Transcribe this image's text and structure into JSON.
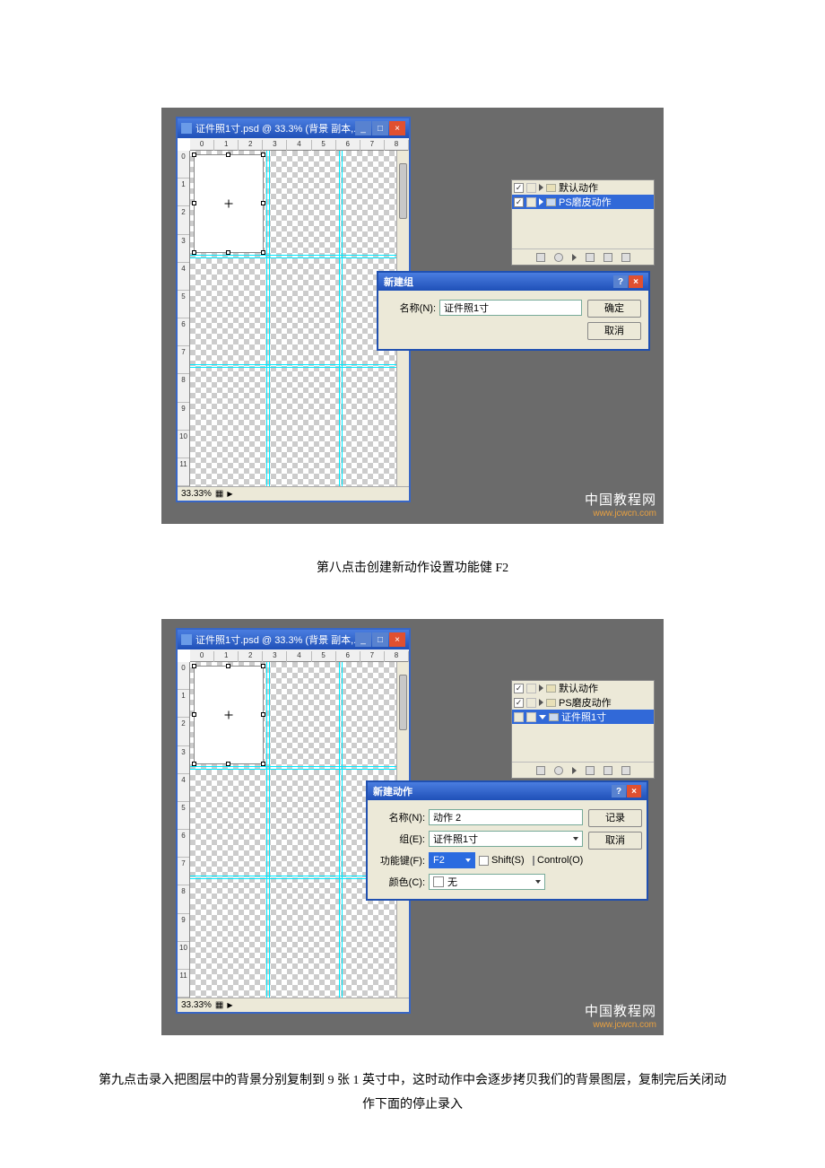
{
  "ps": {
    "title": "证件照1寸.psd @ 33.3% (背景 副本,...",
    "ruler_h": [
      "0",
      "1",
      "2",
      "3",
      "4",
      "5",
      "6",
      "7",
      "8"
    ],
    "ruler_v": [
      "0",
      "1",
      "2",
      "3",
      "4",
      "5",
      "6",
      "7",
      "8",
      "9",
      "10",
      "11"
    ],
    "zoom": "33.33%"
  },
  "actions1": {
    "row1": "默认动作",
    "row2": "PS磨皮动作"
  },
  "dialog1": {
    "title": "新建组",
    "name_label": "名称(N):",
    "name_value": "证件照1寸",
    "ok": "确定",
    "cancel": "取消"
  },
  "caption1": "第八点击创建新动作设置功能健 F2",
  "actions2": {
    "row1": "默认动作",
    "row2": "PS磨皮动作",
    "row3": "证件照1寸"
  },
  "dialog2": {
    "title": "新建动作",
    "name_label": "名称(N):",
    "name_value": "动作 2",
    "set_label": "组(E):",
    "set_value": "证件照1寸",
    "fkey_label": "功能键(F):",
    "fkey_value": "F2",
    "shift_label": "Shift(S)",
    "control_label": "Control(O)",
    "color_label": "颜色(C):",
    "color_value": "无",
    "record": "记录",
    "cancel": "取消"
  },
  "watermark": {
    "main": "中国教程网",
    "sub": "www.jcwcn.com"
  },
  "caption2": "第九点击录入把图层中的背景分别复制到 9 张 1 英寸中，这时动作中会逐步拷贝我们的背景图层，复制完后关闭动作下面的停止录入"
}
